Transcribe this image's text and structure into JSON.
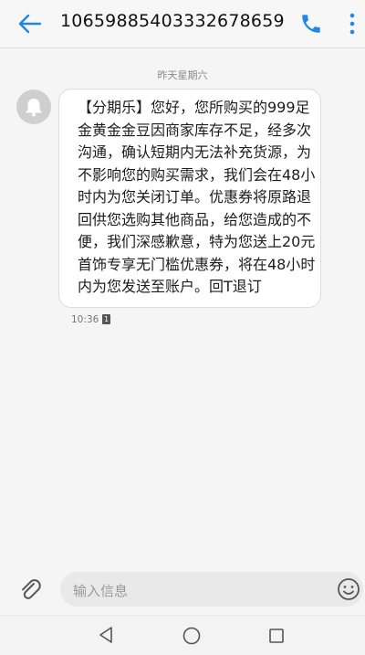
{
  "header": {
    "title": "106598854033326786​59",
    "back_icon": "arrow-left-icon",
    "call_icon": "phone-icon",
    "more_icon": "more-vertical-icon",
    "accent_color": "#1e88e5"
  },
  "conversation": {
    "date_separator": "昨天星期六",
    "messages": [
      {
        "sender_icon": "bell-icon",
        "text": "【分期乐】您好，您所购买的999足金黄金金豆因商家库存不足，经多次沟通，确认短期内无法补充货源，为不影响您的购买需求，我们会在48小时内为您关闭订单。优惠券将原路退回供您选购其他商品，给您造成的不便，我们深感歉意，特为您送上20元首饰专享无门槛优惠券，将在48小时内为您发送至账户。回T退订",
        "time": "10:36",
        "sim": "1"
      }
    ]
  },
  "input": {
    "placeholder": "输入信息",
    "attach_icon": "paperclip-icon",
    "emoji_icon": "emoji-icon"
  },
  "navbar": {
    "back_icon": "triangle-back-icon",
    "home_icon": "circle-home-icon",
    "recents_icon": "square-recents-icon"
  }
}
